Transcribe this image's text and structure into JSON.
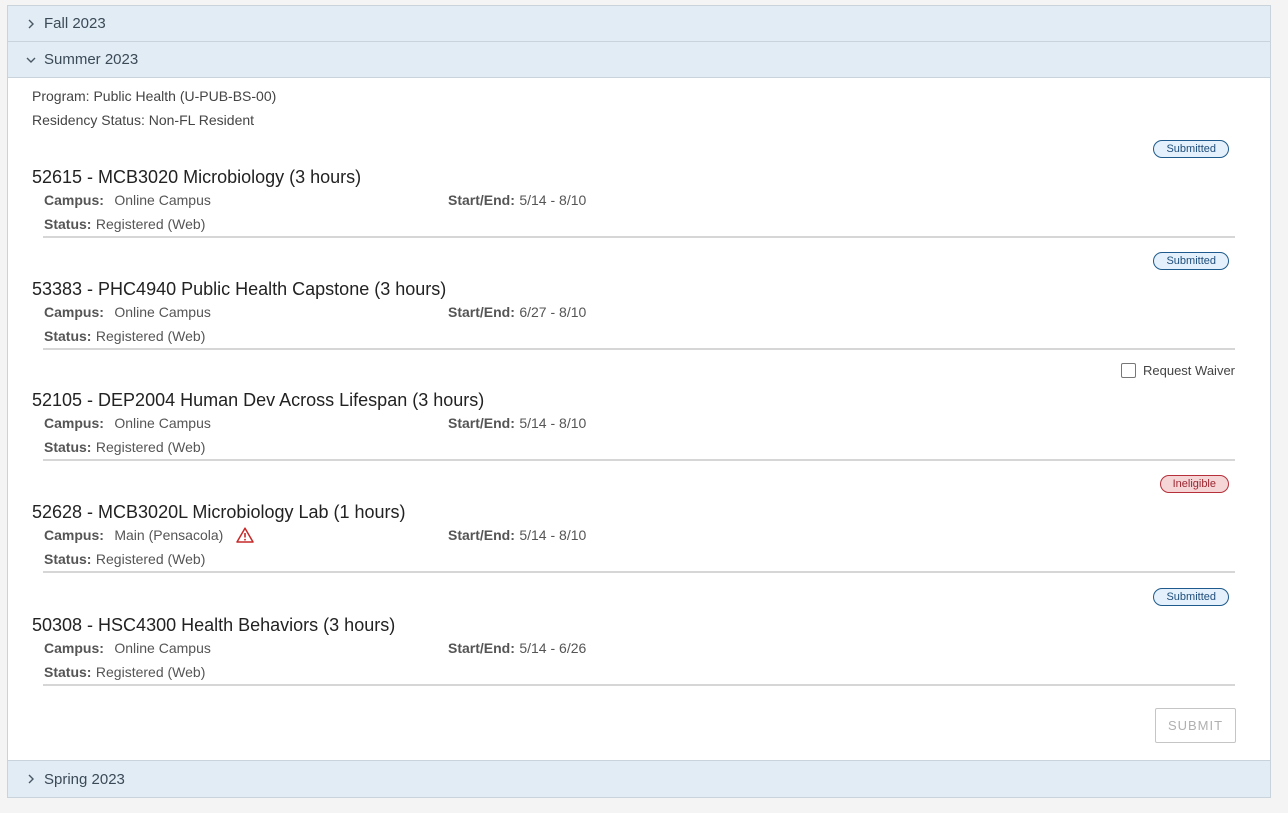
{
  "terms": {
    "fall": {
      "label": "Fall 2023"
    },
    "summer": {
      "label": "Summer 2023"
    },
    "spring": {
      "label": "Spring 2023"
    }
  },
  "summary": {
    "program": "Program: Public Health (U-PUB-BS-00)",
    "residency": "Residency Status: Non-FL Resident"
  },
  "labels": {
    "campus": "Campus:",
    "start_end": "Start/End:",
    "status": "Status:"
  },
  "courses": [
    {
      "title": "52615 - MCB3020 Microbiology (3 hours)",
      "campus": "Online Campus",
      "start_end": "5/14 - 8/10",
      "status": "Registered (Web)",
      "badge": "Submitted"
    },
    {
      "title": "53383 - PHC4940 Public Health Capstone (3 hours)",
      "campus": "Online Campus",
      "start_end": "6/27 - 8/10",
      "status": "Registered (Web)",
      "badge": "Submitted"
    },
    {
      "title": "52105 - DEP2004 Human Dev Across Lifespan (3 hours)",
      "campus": "Online Campus",
      "start_end": "5/14 - 8/10",
      "status": "Registered (Web)",
      "waiver_label": "Request Waiver"
    },
    {
      "title": "52628 - MCB3020L Microbiology Lab (1 hours)",
      "campus": "Main (Pensacola)",
      "start_end": "5/14 - 8/10",
      "status": "Registered (Web)",
      "badge": "Ineligible"
    },
    {
      "title": "50308 - HSC4300 Health Behaviors (3 hours)",
      "campus": "Online Campus",
      "start_end": "5/14 - 6/26",
      "status": "Registered (Web)",
      "badge": "Submitted"
    }
  ],
  "submit_label": "SUBMIT",
  "colors": {
    "header_bg": "#e2ecf5",
    "submitted_border": "#1e5a8c",
    "ineligible_border": "#b5303a",
    "warning_icon": "#c62828"
  },
  "icons": {
    "collapsed": "chevron-right-icon",
    "expanded": "chevron-down-icon",
    "warning": "warning-triangle-icon"
  }
}
